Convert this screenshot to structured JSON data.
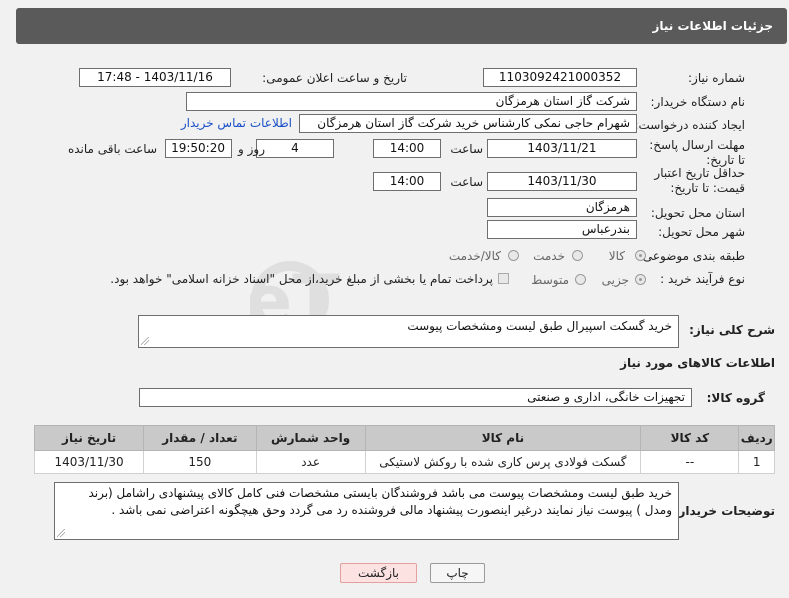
{
  "page_title": "جزئیات اطلاعات نیاز",
  "fields": {
    "need_number_label": "شماره نیاز:",
    "need_number": "1103092421000352",
    "announce_label": "تاریخ و ساعت اعلان عمومی:",
    "announce_value": "1403/11/16 - 17:48",
    "buyer_org_label": "نام دستگاه خریدار:",
    "buyer_org": "شرکت گاز استان هرمزگان",
    "creator_label": "ایجاد کننده درخواست:",
    "creator": "شهرام حاجی نمکی کارشناس خرید شرکت گاز استان هرمزگان",
    "contact_link": "اطلاعات تماس خریدار",
    "deadline_label": "مهلت ارسال پاسخ: تا تاریخ:",
    "deadline_date": "1403/11/21",
    "time_label": "ساعت",
    "deadline_time": "14:00",
    "days_value": "4",
    "days_label": "روز و",
    "remaining_time": "19:50:20",
    "remaining_label": "ساعت باقی مانده",
    "validity_label": "حداقل تاریخ اعتبار قیمت: تا تاریخ:",
    "validity_date": "1403/11/30",
    "validity_time": "14:00",
    "province_label": "استان محل تحویل:",
    "province": "هرمزگان",
    "city_label": "شهر محل تحویل:",
    "city": "بندرعباس",
    "category_label": "طبقه بندی موضوعی:",
    "category_options": [
      "کالا",
      "خدمت",
      "کالا/خدمت"
    ],
    "process_label": "نوع فرآیند خرید :",
    "process_options": [
      "جزیی",
      "متوسط"
    ],
    "payment_note": "پرداخت تمام یا بخشی از مبلغ خرید،از محل \"اسناد خزانه اسلامی\" خواهد بود."
  },
  "description": {
    "label": "شرح کلی نیاز:",
    "value": "خرید گسکت اسپیرال طبق لیست ومشخصات پیوست"
  },
  "goods_section_title": "اطلاعات کالاهای مورد نیاز",
  "goods_group": {
    "label": "گروه کالا:",
    "value": "تجهیزات خانگی، اداری و صنعتی"
  },
  "table": {
    "headers": [
      "ردیف",
      "کد کالا",
      "نام کالا",
      "واحد شمارش",
      "تعداد / مقدار",
      "تاریخ نیاز"
    ],
    "rows": [
      [
        "1",
        "--",
        "گسکت فولادی پرس کاری شده با روکش لاستیکی",
        "عدد",
        "150",
        "1403/11/30"
      ]
    ]
  },
  "buyer_notes": {
    "label": "توضیحات خریدار:",
    "value": "خرید طبق لیست ومشخصات پیوست می باشد  فروشندگان بایستی مشخصات فنی کامل کالای پیشنهادی راشامل (برند ومدل ) پیوست نیاز نمایند درغیر اینصورت پیشنهاد مالی فروشنده رد می گردد وحق هیچگونه اعتراضی نمی باشد ."
  },
  "buttons": {
    "print": "چاپ",
    "back": "بازگشت"
  },
  "watermark_text": "AriaTender.neT",
  "colors": {
    "header_bg": "#5a5a5a",
    "link": "#1a4fc8",
    "table_header_bg": "#c9c9c9",
    "back_button_bg": "#fde2e2"
  }
}
